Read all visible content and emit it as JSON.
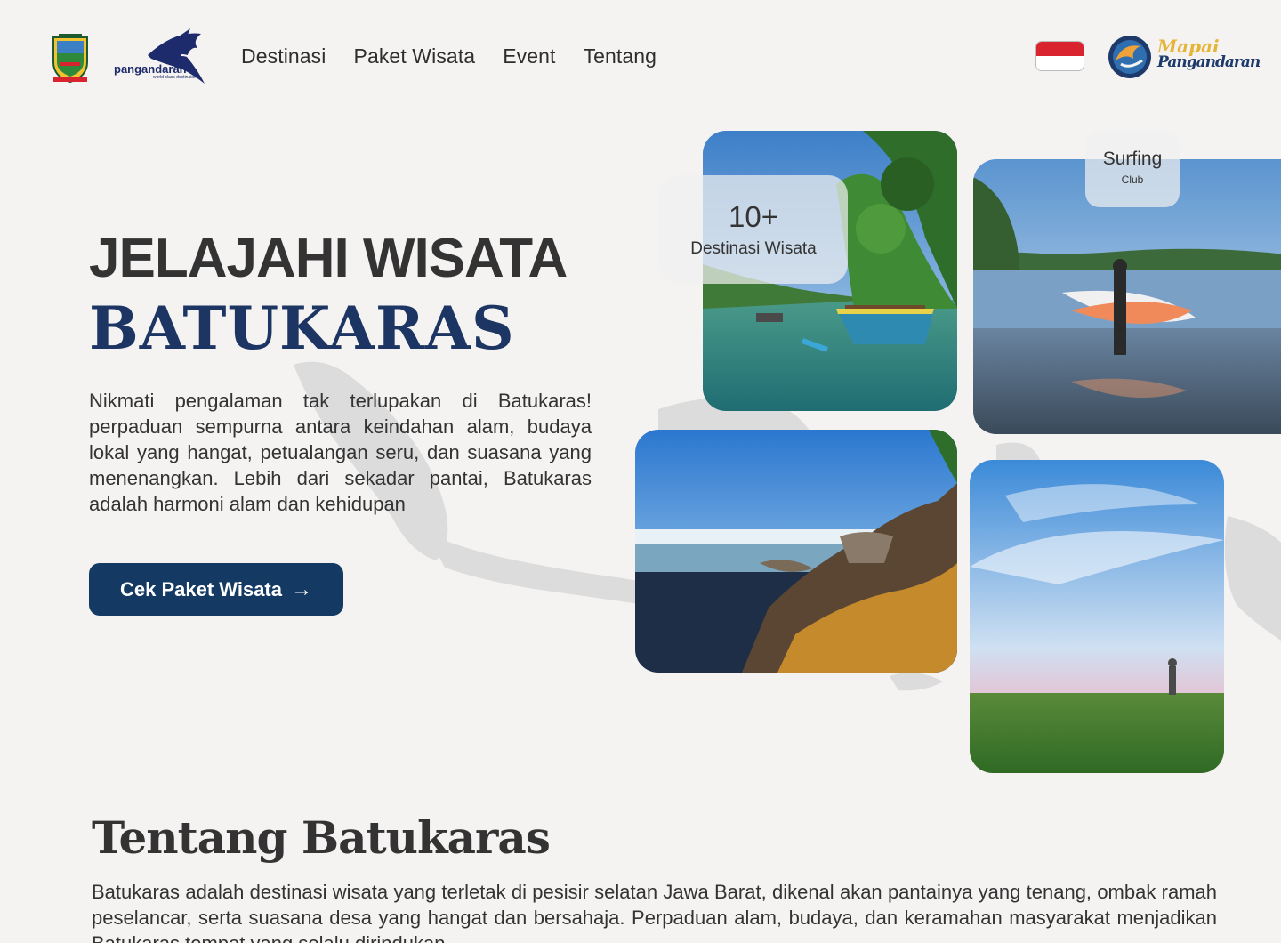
{
  "nav": {
    "items": [
      {
        "label": "Destinasi"
      },
      {
        "label": "Paket Wisata"
      },
      {
        "label": "Event"
      },
      {
        "label": "Tentang"
      }
    ]
  },
  "logos": {
    "pangandaran_word": "pangandaran",
    "pangandaran_tag": "world class destination",
    "mapai_line1": "Mapai",
    "mapai_line2": "Pangandaran"
  },
  "language": {
    "flag": "id-flag-icon"
  },
  "hero": {
    "title_line1": "JELAJAHI WISATA",
    "title_line2": "BATUKARAS",
    "description": "Nikmati pengalaman tak terlupakan di Batukaras! perpaduan sempurna antara keindahan alam, budaya lokal yang hangat, petualangan seru, dan suasana yang menenangkan. Lebih dari sekadar pantai, Batukaras adalah harmoni alam dan kehidupan",
    "cta_label": "Cek Paket Wisata",
    "cta_icon": "arrow-right-icon"
  },
  "stats": {
    "count": "10+",
    "count_label": "Destinasi Wisata"
  },
  "badge": {
    "title": "Surfing",
    "subtitle": "Club"
  },
  "about": {
    "title": "Tentang Batukaras",
    "text": "Batukaras adalah destinasi wisata yang terletak di pesisir selatan Jawa Barat, dikenal akan pantainya yang tenang, ombak ramah peselancar, serta suasana desa yang hangat dan bersahaja. Perpaduan alam, budaya, dan keramahan masyarakat menjadikan Batukaras tempat yang selalu dirindukan."
  },
  "colors": {
    "background": "#f5f3f2",
    "primary": "#143a63",
    "title_accent": "#1c3563",
    "flag_red": "#d9232e"
  }
}
